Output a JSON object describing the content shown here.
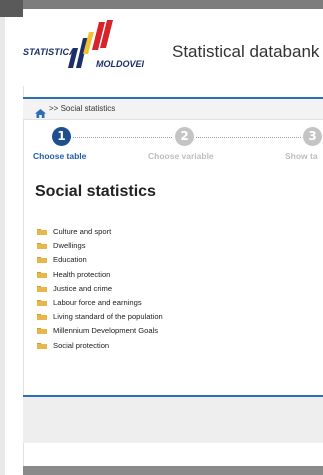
{
  "header": {
    "logo_line1": "STATISTICA",
    "logo_line2": "MOLDOVEI",
    "title": "Statistical databank"
  },
  "breadcrumb": {
    "separator": ">>",
    "current": "Social statistics",
    "home_icon": "home-icon"
  },
  "steps": [
    {
      "number": "1",
      "label": "Choose table",
      "active": true
    },
    {
      "number": "2",
      "label": "Choose variable",
      "active": false
    },
    {
      "number": "3",
      "label": "Show ta",
      "active": false
    }
  ],
  "page": {
    "heading": "Social statistics"
  },
  "categories": [
    "Culture and sport",
    "Dwellings",
    "Education",
    "Health protection",
    "Justice and crime",
    "Labour force and earnings",
    "Living standard of the population",
    "Millennium Development Goals",
    "Social protection"
  ],
  "colors": {
    "accent": "#2c6fb6",
    "step_active": "#1f4e8c",
    "step_label_active": "#1f5fa8",
    "step_inactive": "#c4c4c4",
    "folder": "#e8b64a",
    "logo_red": "#d8232a",
    "logo_blue": "#1b2f6b",
    "logo_yellow": "#f2c232"
  }
}
